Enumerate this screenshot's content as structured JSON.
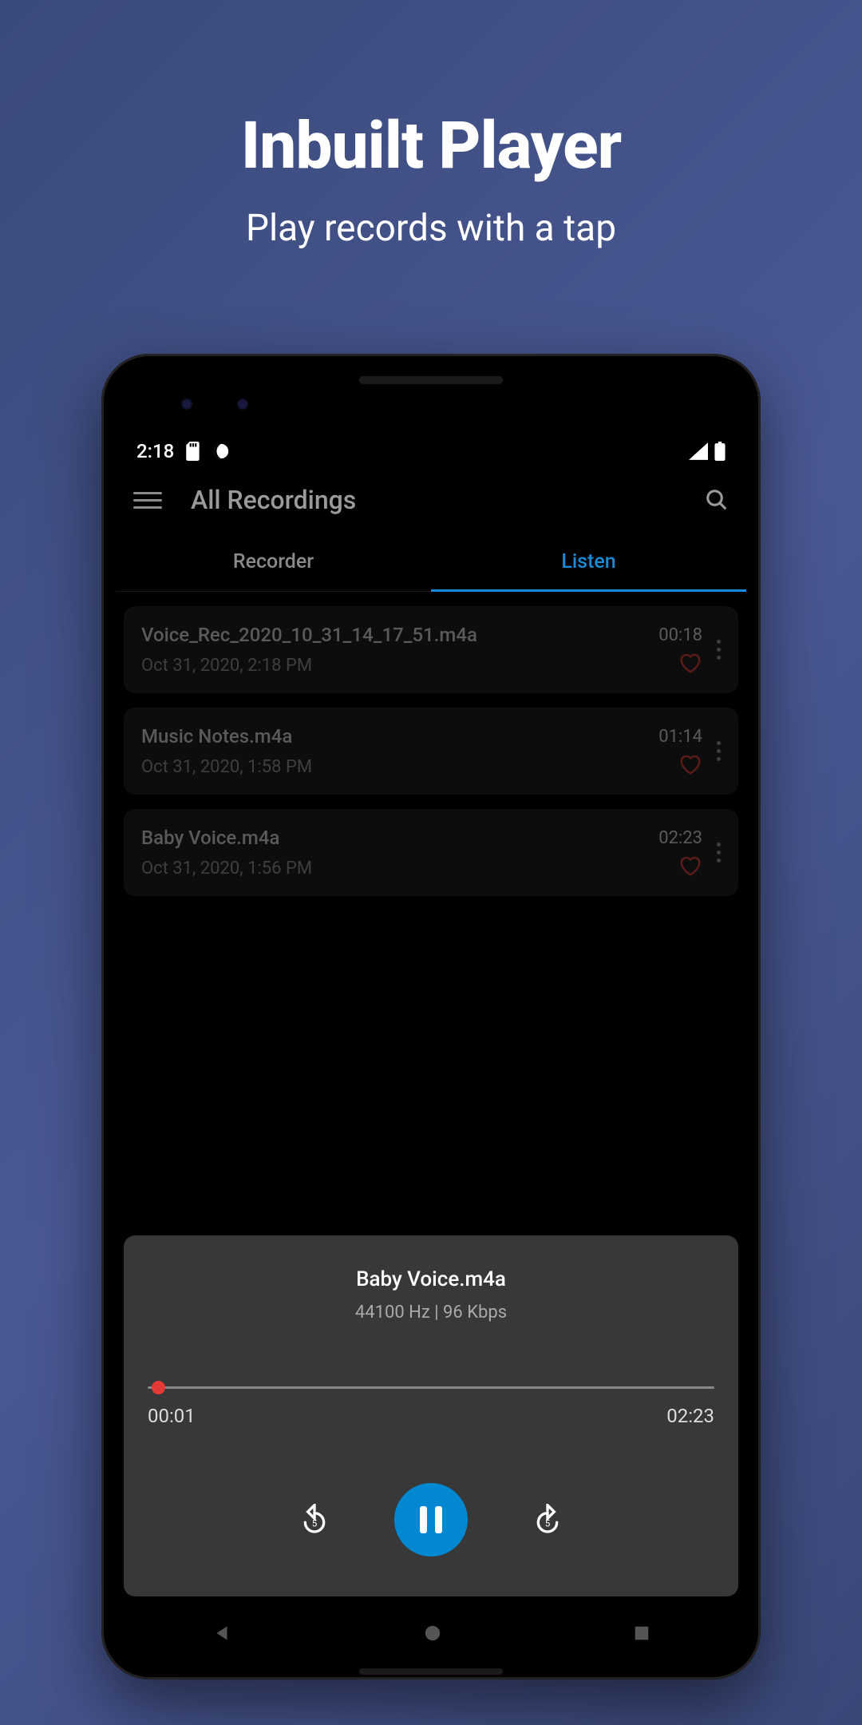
{
  "promo": {
    "title": "Inbuilt Player",
    "subtitle": "Play records with a tap"
  },
  "statusBar": {
    "time": "2:18"
  },
  "header": {
    "title": "All Recordings"
  },
  "tabs": {
    "recorder": "Recorder",
    "listen": "Listen"
  },
  "recordings": [
    {
      "name": "Voice_Rec_2020_10_31_14_17_51.m4a",
      "date": "Oct 31, 2020, 2:18 PM",
      "duration": "00:18"
    },
    {
      "name": "Music Notes.m4a",
      "date": "Oct 31, 2020, 1:58 PM",
      "duration": "01:14"
    },
    {
      "name": "Baby Voice.m4a",
      "date": "Oct 31, 2020, 1:56 PM",
      "duration": "02:23"
    }
  ],
  "player": {
    "title": "Baby Voice.m4a",
    "meta": "44100 Hz | 96 Kbps",
    "elapsed": "00:01",
    "total": "02:23"
  }
}
